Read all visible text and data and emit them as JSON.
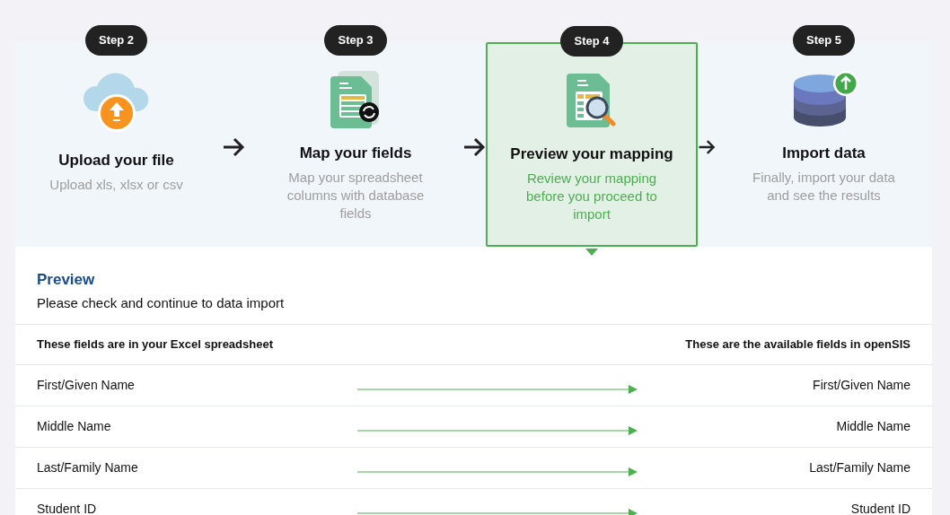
{
  "steps": [
    {
      "badge": "Step 2",
      "title": "Upload your file",
      "description": "Upload xls, xlsx or csv",
      "selected": false
    },
    {
      "badge": "Step 3",
      "title": "Map your fields",
      "description": "Map your spreadsheet columns with database fields",
      "selected": false
    },
    {
      "badge": "Step 4",
      "title": "Preview your mapping",
      "description": "Review your mapping before you proceed to import",
      "selected": true
    },
    {
      "badge": "Step 5",
      "title": "Import data",
      "description": "Finally, import your data and see the results",
      "selected": false
    }
  ],
  "preview": {
    "title": "Preview",
    "subtitle": "Please check and continue to data import",
    "columns": [
      "These fields are in your Excel spreadsheet",
      "These are the available fields in openSIS"
    ],
    "rows": [
      {
        "source": "First/Given Name",
        "target": "First/Given Name"
      },
      {
        "source": "Middle Name",
        "target": "Middle Name"
      },
      {
        "source": "Last/Family Name",
        "target": "Last/Family Name"
      },
      {
        "source": "Student ID",
        "target": "Student ID"
      }
    ]
  }
}
